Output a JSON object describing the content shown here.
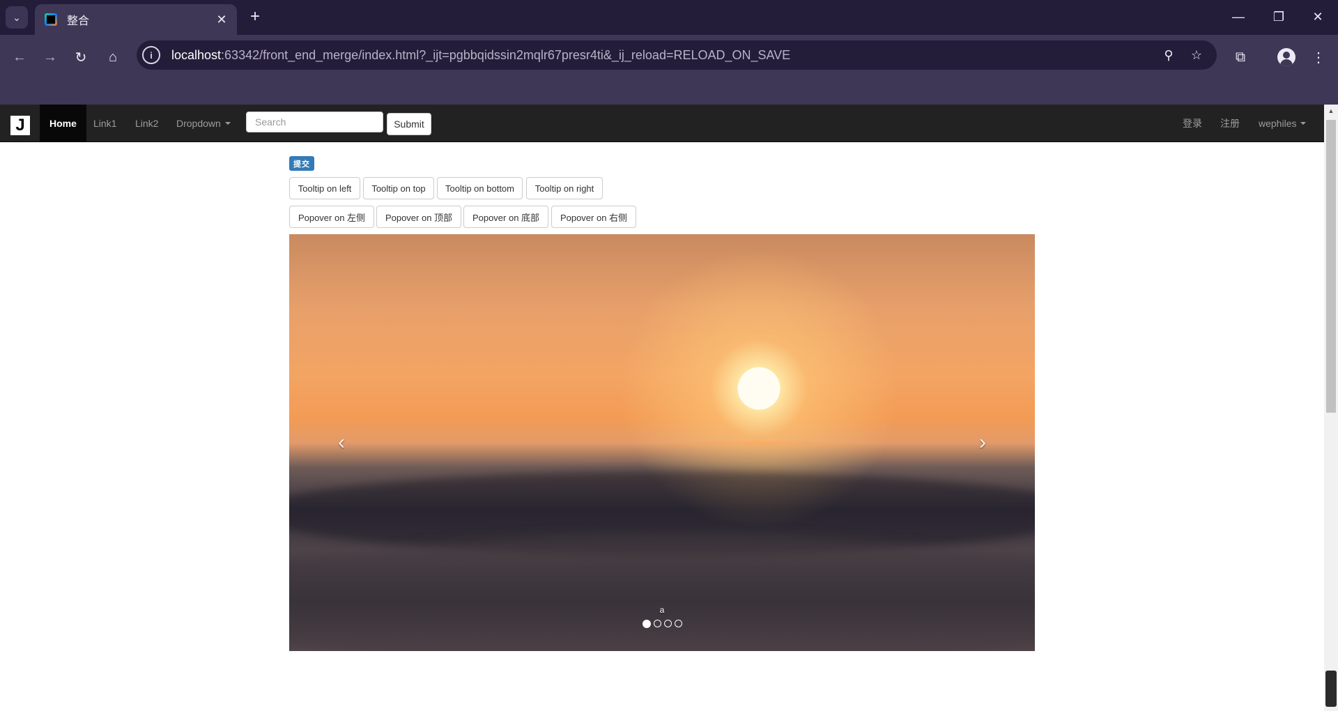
{
  "browser": {
    "tab_title": "整合",
    "url_host": "localhost",
    "url_rest": ":63342/front_end_merge/index.html?_ijt=pgbbqidssin2mqlr67presr4ti&_ij_reload=RELOAD_ON_SAVE"
  },
  "navbar": {
    "brand": "J",
    "items": [
      {
        "label": "Home",
        "active": true
      },
      {
        "label": "Link1"
      },
      {
        "label": "Link2"
      },
      {
        "label": "Dropdown"
      }
    ],
    "search_placeholder": "Search",
    "submit_label": "Submit",
    "right_items": [
      {
        "label": "登录"
      },
      {
        "label": "注册"
      },
      {
        "label": "wephiles"
      }
    ]
  },
  "content": {
    "label": "提交",
    "tooltip_buttons": [
      "Tooltip on left",
      "Tooltip on top",
      "Tooltip on bottom",
      "Tooltip on right"
    ],
    "popover_buttons": [
      "Popover on 左侧",
      "Popover on 顶部",
      "Popover on 底部",
      "Popover on 右侧"
    ],
    "carousel": {
      "caption": "a",
      "slide_count": 4,
      "active_index": 0,
      "prev_glyph": "‹",
      "next_glyph": "›"
    }
  }
}
